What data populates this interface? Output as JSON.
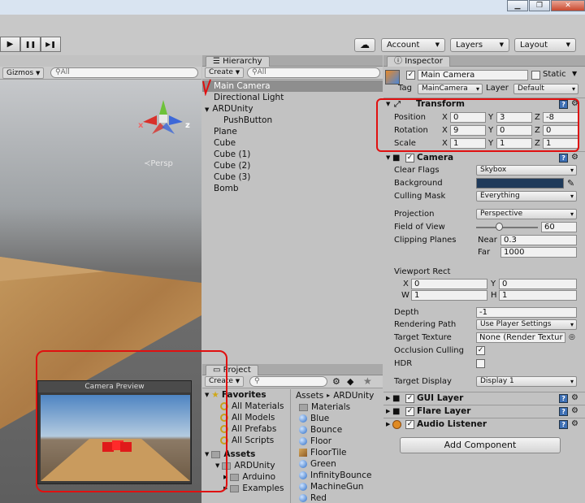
{
  "window": {
    "minimize": "▁",
    "maximize": "❐",
    "close": "✕"
  },
  "toolbar": {
    "play": "▶",
    "pause": "❚❚",
    "step": "▶❚",
    "cloud": "☁",
    "account": "Account",
    "layers": "Layers",
    "layout": "Layout"
  },
  "scene": {
    "gizmos": "Gizmos",
    "search_placeholder": "All",
    "persp": "Persp",
    "gizmo_x": "x",
    "gizmo_z": "z"
  },
  "camera_preview": {
    "title": "Camera Preview"
  },
  "hierarchy": {
    "tab": "Hierarchy",
    "create": "Create",
    "search_placeholder": "All",
    "items": [
      {
        "label": "Main Camera",
        "depth": 0,
        "selected": true
      },
      {
        "label": "Directional Light",
        "depth": 0
      },
      {
        "label": "ARDUnity",
        "depth": 0,
        "expanded": true
      },
      {
        "label": "PushButton",
        "depth": 1
      },
      {
        "label": "Plane",
        "depth": 0
      },
      {
        "label": "Cube",
        "depth": 0
      },
      {
        "label": "Cube (1)",
        "depth": 0
      },
      {
        "label": "Cube (2)",
        "depth": 0
      },
      {
        "label": "Cube (3)",
        "depth": 0
      },
      {
        "label": "Bomb",
        "depth": 0
      }
    ]
  },
  "project": {
    "tab": "Project",
    "create": "Create",
    "breadcrumb_root": "Assets",
    "breadcrumb_sep": "▸",
    "breadcrumb_current": "ARDUnity",
    "favorites_label": "Favorites",
    "favorites": [
      "All Materials",
      "All Models",
      "All Prefabs",
      "All Scripts"
    ],
    "assets_label": "Assets",
    "asset_tree": [
      {
        "label": "ARDUnity",
        "depth": 1
      },
      {
        "label": "Arduino",
        "depth": 2
      },
      {
        "label": "Examples",
        "depth": 2
      }
    ],
    "files": [
      {
        "label": "Materials",
        "kind": "folder"
      },
      {
        "label": "Blue",
        "kind": "sphere"
      },
      {
        "label": "Bounce",
        "kind": "sphere"
      },
      {
        "label": "Floor",
        "kind": "sphere"
      },
      {
        "label": "FloorTile",
        "kind": "texture"
      },
      {
        "label": "Green",
        "kind": "sphere"
      },
      {
        "label": "InfinityBounce",
        "kind": "sphere"
      },
      {
        "label": "MachineGun",
        "kind": "sphere"
      },
      {
        "label": "Red",
        "kind": "sphere"
      }
    ]
  },
  "inspector": {
    "tab": "Inspector",
    "object_name": "Main Camera",
    "static_label": "Static",
    "tag_label": "Tag",
    "tag_value": "MainCamera",
    "layer_label": "Layer",
    "layer_value": "Default",
    "transform": {
      "title": "Transform",
      "position_label": "Position",
      "rotation_label": "Rotation",
      "scale_label": "Scale",
      "x_label": "X",
      "y_label": "Y",
      "z_label": "Z",
      "position": {
        "x": "0",
        "y": "3",
        "z": "-8"
      },
      "rotation": {
        "x": "9",
        "y": "0",
        "z": "0"
      },
      "scale": {
        "x": "1",
        "y": "1",
        "z": "1"
      }
    },
    "camera": {
      "title": "Camera",
      "clear_flags_label": "Clear Flags",
      "clear_flags": "Skybox",
      "background_label": "Background",
      "background_color": "#1f3a5a",
      "culling_mask_label": "Culling Mask",
      "culling_mask": "Everything",
      "projection_label": "Projection",
      "projection": "Perspective",
      "fov_label": "Field of View",
      "fov": "60",
      "fov_fraction": 0.33,
      "clipping_label": "Clipping Planes",
      "near_label": "Near",
      "near": "0.3",
      "far_label": "Far",
      "far": "1000",
      "viewport_label": "Viewport Rect",
      "vx_label": "X",
      "vx": "0",
      "vy_label": "Y",
      "vy": "0",
      "vw_label": "W",
      "vw": "1",
      "vh_label": "H",
      "vh": "1",
      "depth_label": "Depth",
      "depth": "-1",
      "rendering_path_label": "Rendering Path",
      "rendering_path": "Use Player Settings",
      "target_texture_label": "Target Texture",
      "target_texture": "None (Render Textur",
      "occlusion_label": "Occlusion Culling",
      "hdr_label": "HDR",
      "target_display_label": "Target Display",
      "target_display": "Display 1"
    },
    "components": [
      "GUI Layer",
      "Flare Layer",
      "Audio Listener"
    ],
    "add_component": "Add Component"
  },
  "colors": {
    "annotation_red": "#e01010",
    "selection": "#8e8e8e"
  }
}
